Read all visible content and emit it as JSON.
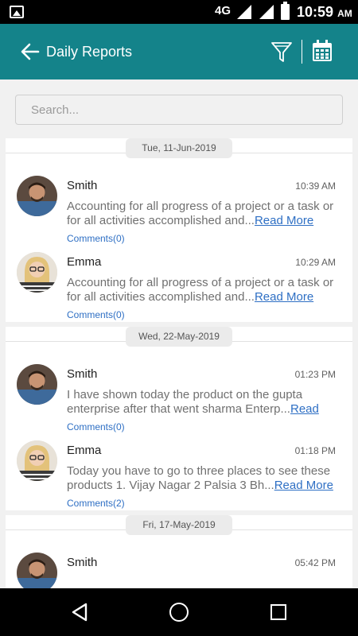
{
  "status_bar": {
    "network": "4G",
    "time": "10:59",
    "ampm": "AM"
  },
  "app_bar": {
    "title": "Daily Reports"
  },
  "search": {
    "placeholder": "Search..."
  },
  "groups": [
    {
      "date": "Tue, 11-Jun-2019",
      "reports": [
        {
          "name": "Smith",
          "time": "10:39 AM",
          "text": "Accounting for all progress of a project or a task or for all activities accomplished and...",
          "read_more": "Read More",
          "comments": "Comments(0)",
          "avatar": "man"
        },
        {
          "name": "Emma",
          "time": "10:29 AM",
          "text": "Accounting for all progress of a project or a task or for all activities accomplished and...",
          "read_more": "Read More",
          "comments": "Comments(0)",
          "avatar": "woman"
        }
      ]
    },
    {
      "date": "Wed, 22-May-2019",
      "reports": [
        {
          "name": "Smith",
          "time": "01:23 PM",
          "text": "I have shown today the product on the gupta enterprise after that went sharma Enterp...",
          "read_more": "Read",
          "comments": "Comments(0)",
          "avatar": "man"
        },
        {
          "name": "Emma",
          "time": "01:18 PM",
          "text": "Today you have to go to three places to see these products 1. Vijay Nagar 2 Palsia 3 Bh...",
          "read_more": "Read More",
          "comments": "Comments(2)",
          "avatar": "woman"
        }
      ]
    },
    {
      "date": "Fri, 17-May-2019",
      "reports": [
        {
          "name": "Smith",
          "time": "05:42 PM",
          "text": "",
          "read_more": "",
          "comments": "",
          "avatar": "man"
        }
      ]
    }
  ],
  "colors": {
    "app_bar": "#14838a",
    "link": "#2e6fc4",
    "background": "#f1f1f1"
  },
  "icons": [
    "image-icon",
    "signal-icon",
    "battery-icon",
    "back-arrow-icon",
    "filter-icon",
    "calendar-icon",
    "nav-back-icon",
    "nav-home-icon",
    "nav-recent-icon"
  ]
}
